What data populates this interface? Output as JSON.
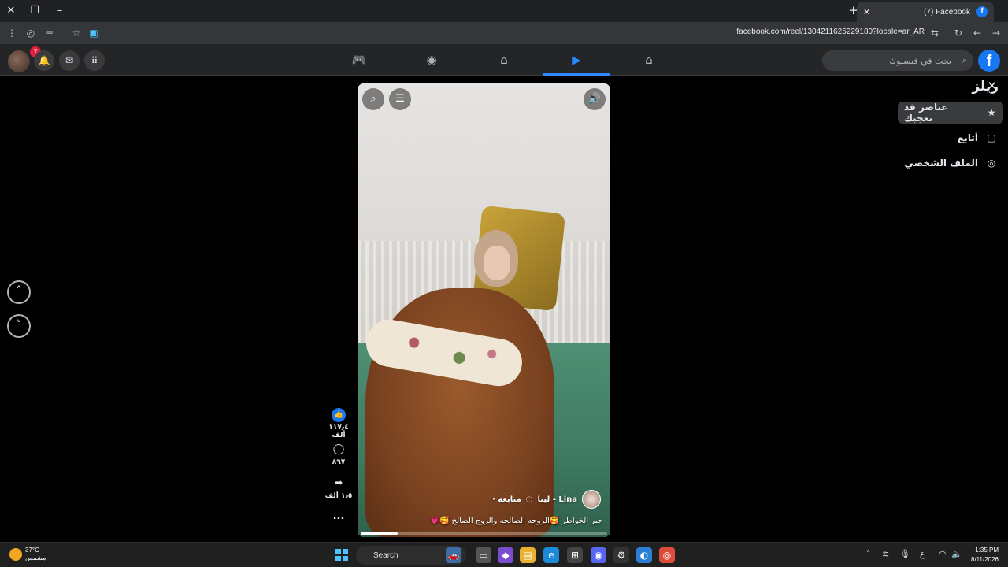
{
  "browser": {
    "tab_title": "(7) Facebook",
    "url": "facebook.com/reel/1304211625229180?locale=ar_AR"
  },
  "header": {
    "search_placeholder": "بحث في فيسبوك",
    "notification_count": "7"
  },
  "sidebar": {
    "title": "ريلز",
    "items": [
      {
        "label": "عناصر قد تعجبك",
        "icon": "star-icon"
      },
      {
        "label": "أتابع",
        "icon": "following-icon"
      },
      {
        "label": "الملف الشخصي",
        "icon": "profile-icon"
      }
    ]
  },
  "reel": {
    "owner": "لينا - Lina",
    "follow_label": "· متابعة",
    "caption": "جبر الخواطر 🥰الزوجه الصالحه والزوج الصالح 🥰💗",
    "progress": 0.15,
    "likes": "١١٧٫٤ ألف",
    "comments": "٨٩٧",
    "shares": "١٫٥ ألف",
    "more": "..."
  },
  "taskbar": {
    "weather_temp": "37°C",
    "weather_desc": "مشمس",
    "search_placeholder": "Search",
    "time": "1:35 PM",
    "date": "8/11/2026",
    "lang": "ع"
  },
  "colors": {
    "accent": "#2d88ff",
    "brand": "#1877f2",
    "header_bg": "#242526"
  }
}
